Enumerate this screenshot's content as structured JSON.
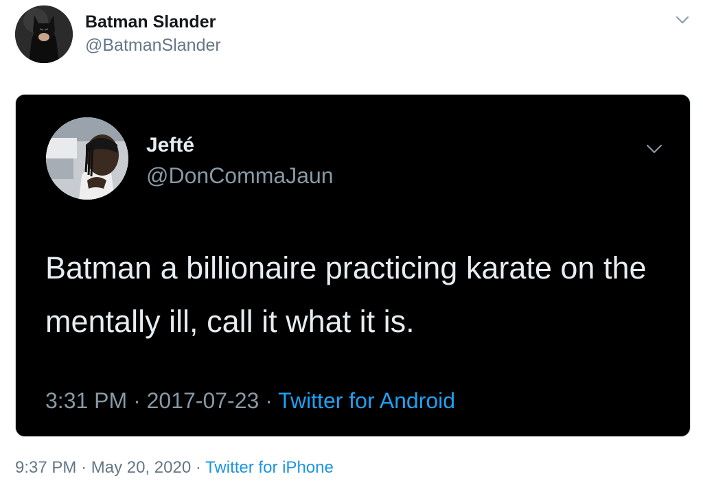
{
  "tweet": {
    "author": {
      "name": "Batman Slander",
      "handle": "@BatmanSlander",
      "avatar_icon": "batman-avatar"
    },
    "menu_icon": "chevron-down-icon",
    "quoted": {
      "author": {
        "name": "Jefté",
        "handle": "@DonCommaJaun",
        "avatar_icon": "person-avatar"
      },
      "menu_icon": "chevron-down-icon",
      "text": "Batman a billionaire practicing karate on the mentally ill, call it what it is.",
      "time": "3:31 PM",
      "date": "2017-07-23",
      "separator": "·",
      "source": "Twitter for Android"
    },
    "time": "9:37 PM",
    "date": "May 20, 2020",
    "separator": "·",
    "source": "Twitter for iPhone"
  },
  "colors": {
    "link": "#1b95e0",
    "dark_link": "#1da1f2",
    "card_bg": "#000000",
    "muted": "#657786"
  }
}
